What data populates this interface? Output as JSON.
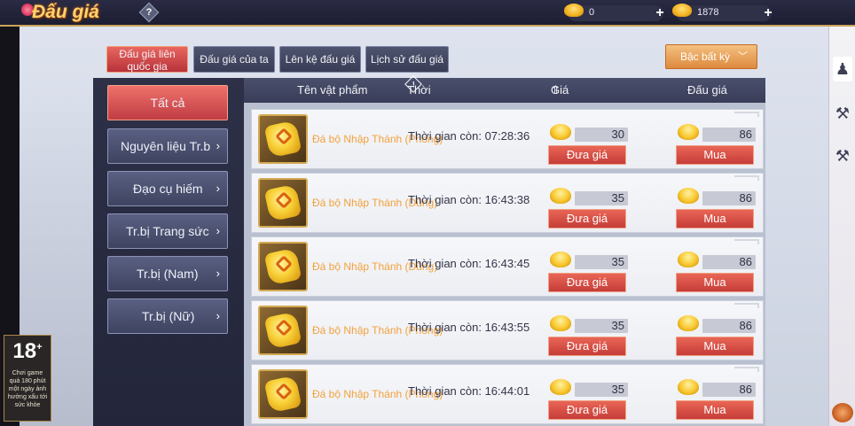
{
  "header": {
    "title": "Đấu giá",
    "help_label": "?",
    "currencies": [
      {
        "icon": "gold-ingot-icon",
        "amount": "0",
        "plus": "+"
      },
      {
        "icon": "bound-ingot-icon",
        "amount": "1878",
        "plus": "+"
      }
    ]
  },
  "tabs": [
    {
      "label": "Đấu giá liên\nquốc gia",
      "active": true
    },
    {
      "label": "Đấu giá của ta",
      "active": false
    },
    {
      "label": "Lên kệ đấu giá",
      "active": false
    },
    {
      "label": "Lịch sử đấu giá",
      "active": false
    }
  ],
  "sort_dropdown": {
    "label": "Bậc bất kỳ",
    "icon": "chevron-down-icon"
  },
  "categories": [
    {
      "label": "Tất cả",
      "active": true
    },
    {
      "label": "Nguyên liệu Tr.b",
      "active": false
    },
    {
      "label": "Đạo cụ hiếm",
      "active": false
    },
    {
      "label": "Tr.bị Trang sức",
      "active": false
    },
    {
      "label": "Tr.bị (Nam)",
      "active": false
    },
    {
      "label": "Tr.bị (Nữ)",
      "active": false
    }
  ],
  "table": {
    "columns": [
      "Tên vật phẩm",
      "Thời gian còn",
      "Giá hiện tại",
      "Đấu giá"
    ],
    "rows": [
      {
        "name": "Đá bộ Nhập Thánh (Phong)",
        "time": "Thời gian còn: 07:28:36",
        "current_price": "30",
        "buyout_price": "86",
        "bid_label": "Đưa giá",
        "buy_label": "Mua",
        "icon": "wind-stone-icon"
      },
      {
        "name": "Đá bộ Nhập Thánh (Dũng)",
        "time": "Thời gian còn: 16:43:38",
        "current_price": "35",
        "buyout_price": "86",
        "bid_label": "Đưa giá",
        "buy_label": "Mua",
        "icon": "sword-stone-icon"
      },
      {
        "name": "Đá bộ Nhập Thánh (Dũng)",
        "time": "Thời gian còn: 16:43:45",
        "current_price": "35",
        "buyout_price": "86",
        "bid_label": "Đưa giá",
        "buy_label": "Mua",
        "icon": "sword-stone-icon"
      },
      {
        "name": "Đá bộ Nhập Thánh (Phong)",
        "time": "Thời gian còn: 16:43:55",
        "current_price": "35",
        "buyout_price": "86",
        "bid_label": "Đưa giá",
        "buy_label": "Mua",
        "icon": "wind-stone-icon"
      },
      {
        "name": "Đá bộ Nhập Thánh (Phong)",
        "time": "Thời gian còn: 16:44:01",
        "current_price": "35",
        "buyout_price": "86",
        "bid_label": "Đưa giá",
        "buy_label": "Mua",
        "icon": "wind-stone-icon"
      }
    ]
  },
  "age_rating": {
    "number": "18",
    "plus": "+",
    "note": "Chơi game quá 180 phút một ngày ảnh hưởng xấu tới sức khỏe"
  }
}
